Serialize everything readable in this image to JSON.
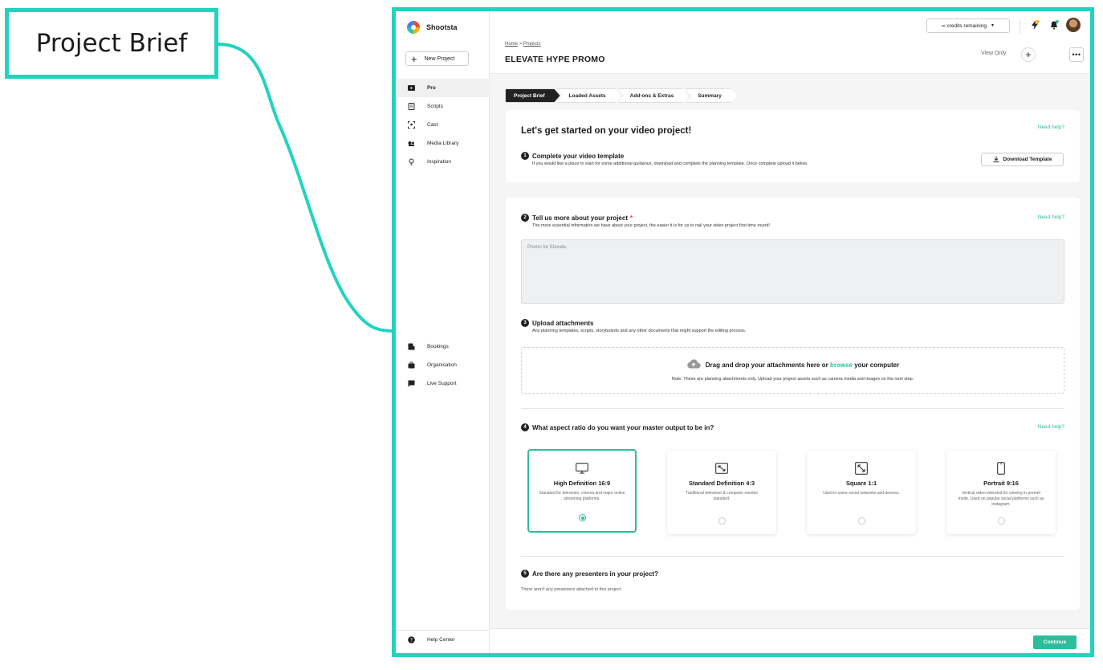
{
  "callout": {
    "label": "Project Brief"
  },
  "sidebar": {
    "brand": "Shootsta",
    "new_project_label": "New Project",
    "items": [
      {
        "label": "Pro",
        "icon": "video-play-icon",
        "active": true
      },
      {
        "label": "Scripts",
        "icon": "script-icon"
      },
      {
        "label": "Cast",
        "icon": "cast-icon"
      },
      {
        "label": "Media Library",
        "icon": "media-library-icon"
      },
      {
        "label": "Inspiration",
        "icon": "lightbulb-icon"
      }
    ],
    "bottom_items": [
      {
        "label": "Bookings",
        "icon": "bookings-icon"
      },
      {
        "label": "Organisation",
        "icon": "briefcase-icon"
      },
      {
        "label": "Live Support",
        "icon": "chat-icon"
      }
    ],
    "help_center": "Help Center"
  },
  "header": {
    "credits_label": "∞ credits remaining",
    "breadcrumb": {
      "home": "Home",
      "separator": ">",
      "projects": "Projects"
    },
    "title": "ELEVATE HYPE PROMO",
    "view_only": "View Only"
  },
  "steps": [
    {
      "label": "Project Brief",
      "active": true
    },
    {
      "label": "Loaded Assets"
    },
    {
      "label": "Add-ons & Extras"
    },
    {
      "label": "Summary"
    }
  ],
  "intro": {
    "heading": "Let's get started on your video project!",
    "need_help": "Need help?",
    "step1": {
      "num": "1",
      "title": "Complete your video template",
      "sub": "If you would like a place to start for some additional guidance, download and complete the planning template. Once complete upload it below.",
      "button": "Download Template"
    }
  },
  "details": {
    "step2": {
      "num": "2",
      "title": "Tell us more about your project",
      "required": "*",
      "sub": "The more essential information we have about your project, the easier it is for us to nail your video project first time round!",
      "need_help": "Need help?",
      "value": "Promo for Elevate."
    },
    "step3": {
      "num": "3",
      "title": "Upload attachments",
      "sub": "Any planning templates, scripts, storyboards and any other documents that might support the editing process.",
      "drop_prefix": "Drag and drop your attachments here or",
      "drop_link": "browse",
      "drop_suffix": "your computer",
      "note": "Note: These are planning attachments only. Upload your project assets such as camera media and images on the next step."
    },
    "step4": {
      "num": "4",
      "title": "What aspect ratio do you want your master output to be in?",
      "need_help": "Need help?",
      "options": [
        {
          "title": "High Definition 16:9",
          "desc": "Standard for television, cinema and major online streaming platforms.",
          "icon": "monitor-icon",
          "selected": true
        },
        {
          "title": "Standard Definition 4:3",
          "desc": "Traditional television & computer monitor standard.",
          "icon": "expand-diagonal-icon",
          "selected": false
        },
        {
          "title": "Square 1:1",
          "desc": "Used in some social networks and devices.",
          "icon": "expand-square-icon",
          "selected": false
        },
        {
          "title": "Portrait 9:16",
          "desc": "Vertical video intended for viewing in portrait mode. Used on popular social platforms such as Instagram.",
          "icon": "phone-icon",
          "selected": false
        }
      ]
    },
    "step5": {
      "num": "5",
      "title": "Are there any presenters in your project?",
      "empty": "There aren't any presenters attached to this project."
    }
  },
  "footer": {
    "continue": "Continue"
  },
  "colors": {
    "accent": "#2ebd9b",
    "callout": "#22d3c0"
  }
}
